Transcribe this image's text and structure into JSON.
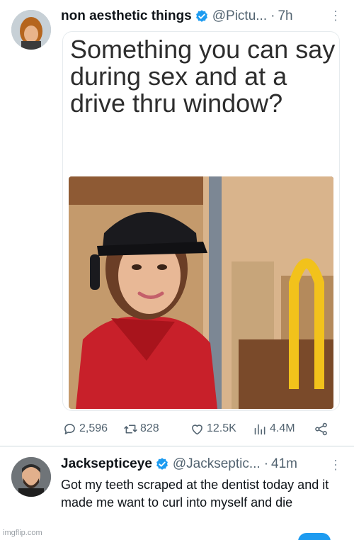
{
  "tweets": [
    {
      "display_name": "non aesthetic things",
      "handle": "@Pictu...",
      "separator": "·",
      "time": "7h",
      "meme_text": "Something you can say during sex and at a drive thru window?",
      "stats": {
        "replies": "2,596",
        "retweets": "828",
        "likes": "12.5K",
        "views": "4.4M"
      }
    },
    {
      "display_name": "Jacksepticeye",
      "handle": "@Jackseptic...",
      "separator": "·",
      "time": "41m",
      "text": "Got my teeth scraped at the dentist today and it made me want to curl into myself and die"
    }
  ],
  "watermark": "imgflip.com",
  "colors": {
    "verified": "#1d9bf0",
    "secondary_text": "#536471",
    "primary_text": "#0f1419",
    "mcdonalds_arch": "#f2c21b",
    "uniform_red": "#c8202a"
  },
  "icons": [
    "verified-badge-icon",
    "more-options-icon",
    "reply-icon",
    "retweet-icon",
    "like-icon",
    "views-icon",
    "share-icon"
  ]
}
